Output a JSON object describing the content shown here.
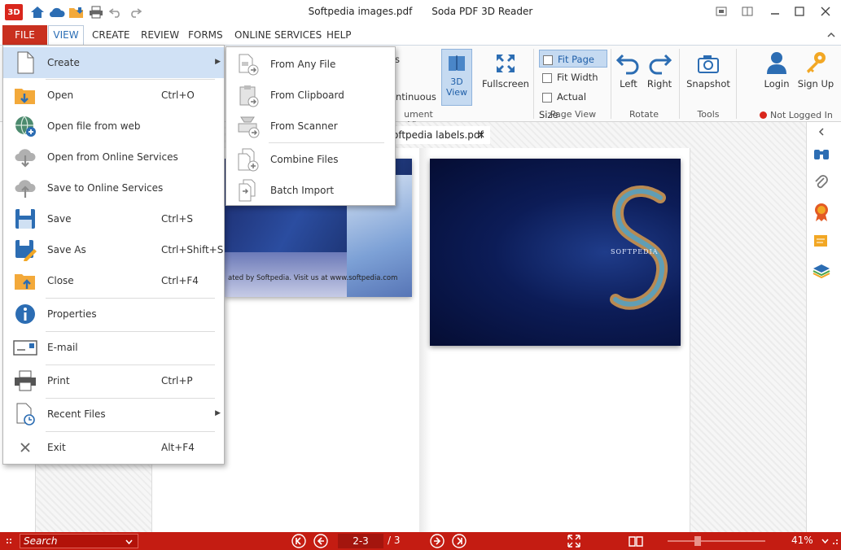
{
  "window": {
    "file_name": "Softpedia images.pdf",
    "app_name": "Soda PDF 3D Reader",
    "app_logo_text": "3D"
  },
  "menu": {
    "file": "FILE",
    "view": "VIEW",
    "create": "CREATE",
    "review": "REVIEW",
    "forms": "FORMS",
    "online_services": "ONLINE SERVICES",
    "help": "HELP"
  },
  "ribbon": {
    "partial_label": "s",
    "continuous": "ntinuous",
    "document_view_group": "ument View",
    "view3d": "3D View",
    "view3d_line1": "3D",
    "view3d_line2": "View",
    "fullscreen": "Fullscreen",
    "fit_page": "Fit Page",
    "fit_width": "Fit Width",
    "actual_size": "Actual Size",
    "page_view_group": "Page View",
    "left": "Left",
    "right": "Right",
    "rotate_group": "Rotate",
    "snapshot": "Snapshot",
    "tools_group": "Tools",
    "login": "Login",
    "sign_up": "Sign Up",
    "status": "Not Logged In"
  },
  "document": {
    "tab_title": "oftpedia labels.pdf",
    "left_page_caption": "ated by Softpedia. Visit us at www.softpedia.com",
    "right_page_brand": "SOFTPEDIA"
  },
  "file_menu": {
    "items": [
      {
        "label": "Create",
        "shortcut": "",
        "has_submenu": true
      },
      {
        "label": "Open",
        "shortcut": "Ctrl+O"
      },
      {
        "label": "Open file from web",
        "shortcut": ""
      },
      {
        "label": "Open from Online Services",
        "shortcut": ""
      },
      {
        "label": "Save to Online Services",
        "shortcut": ""
      },
      {
        "label": "Save",
        "shortcut": "Ctrl+S"
      },
      {
        "label": "Save As",
        "shortcut": "Ctrl+Shift+S"
      },
      {
        "label": "Close",
        "shortcut": "Ctrl+F4"
      },
      {
        "label": "Properties",
        "shortcut": ""
      },
      {
        "label": "E-mail",
        "shortcut": ""
      },
      {
        "label": "Print",
        "shortcut": "Ctrl+P"
      },
      {
        "label": "Recent Files",
        "shortcut": "",
        "has_submenu": true
      },
      {
        "label": "Exit",
        "shortcut": "Alt+F4"
      }
    ]
  },
  "create_submenu": {
    "items": [
      {
        "label": "From Any File"
      },
      {
        "label": "From Clipboard"
      },
      {
        "label": "From Scanner"
      },
      {
        "label": "Combine Files"
      },
      {
        "label": "Batch Import"
      }
    ]
  },
  "statusbar": {
    "search_placeholder": "Search",
    "page_value": "2-3",
    "page_total": "/ 3",
    "zoom": "41%"
  },
  "colors": {
    "accent_red": "#c41c12",
    "file_tab": "#c9301f",
    "selection_blue": "#c5daf1",
    "link_blue": "#2a6db5"
  }
}
